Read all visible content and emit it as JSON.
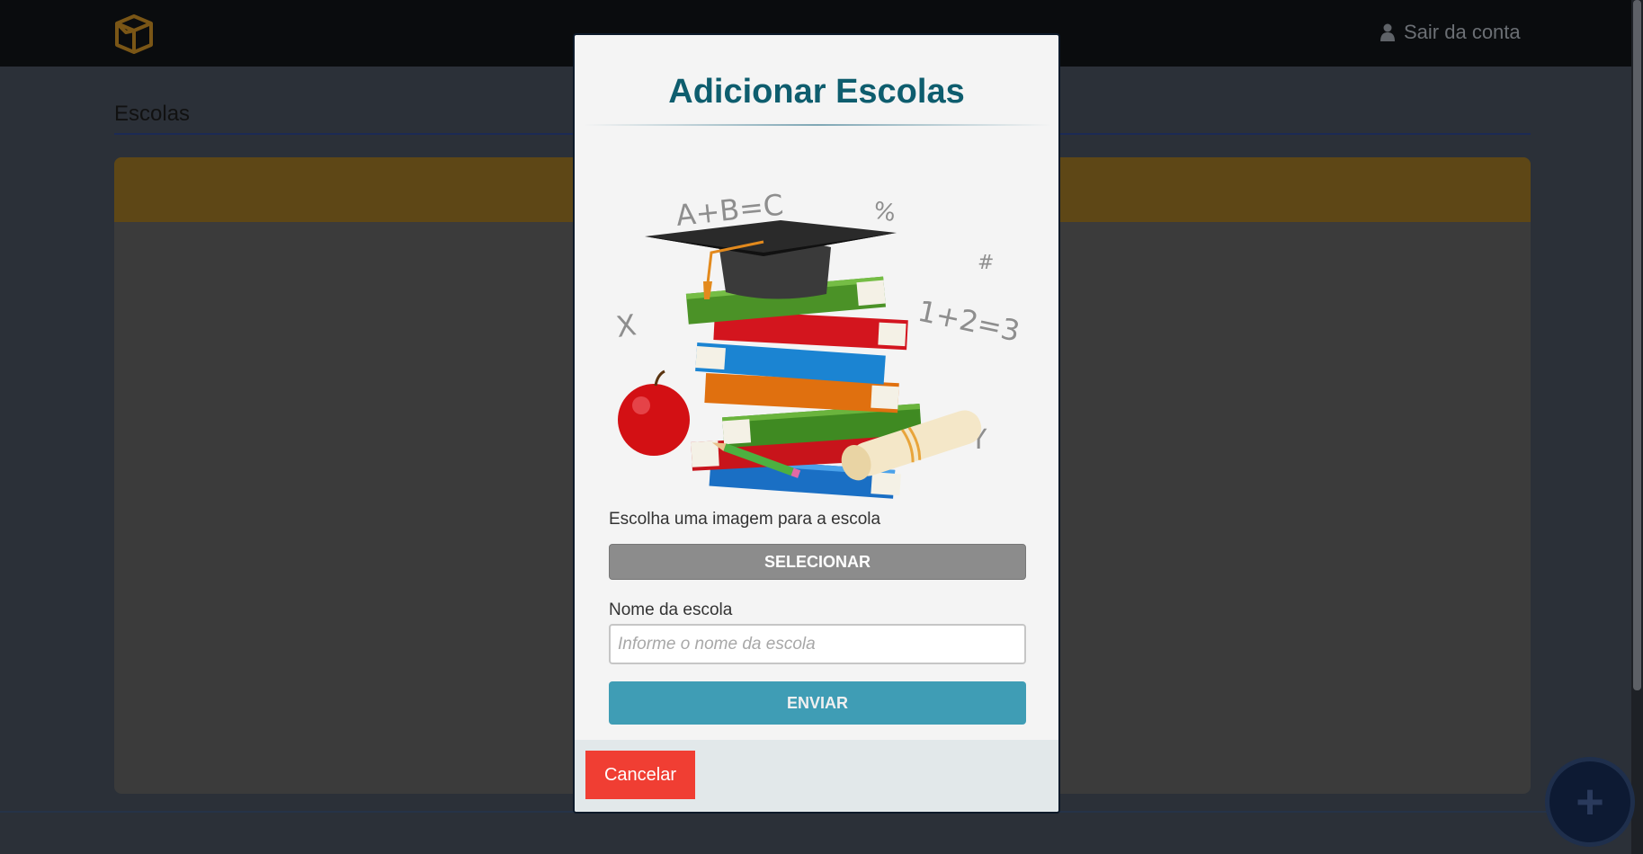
{
  "header": {
    "logo_icon": "open-box-icon",
    "logout_label": "Sair da conta",
    "logout_icon": "user-icon"
  },
  "page": {
    "heading": "Escolas"
  },
  "fab": {
    "icon": "plus-icon"
  },
  "modal": {
    "title": "Adicionar Escolas",
    "illustration_text": {
      "formula1": "A+B=C",
      "percent": "%",
      "hash": "#",
      "formula2": "1+2=3",
      "x": "X",
      "at": "@",
      "y": "Y"
    },
    "image_label": "Escolha uma imagem para a escola",
    "select_button": "SELECIONAR",
    "name_label": "Nome da escola",
    "name_placeholder": "Informe o nome da escola",
    "name_value": "",
    "submit_button": "ENVIAR",
    "cancel_button": "Cancelar"
  },
  "colors": {
    "title": "#0e5d6e",
    "submit": "#3f9db5",
    "select": "#8c8c8c",
    "cancel": "#f03e33",
    "header_bar": "#5e4716"
  }
}
